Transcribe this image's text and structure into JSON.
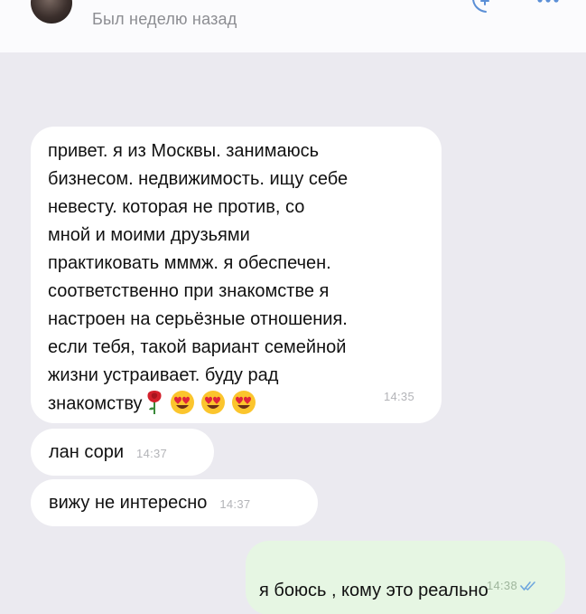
{
  "header": {
    "last_seen": "Был неделю назад",
    "avatar_icon": "avatar",
    "call_icon": "phone-plus-icon",
    "more_icon": "more-dots-icon"
  },
  "messages": [
    {
      "direction": "incoming",
      "text": "привет. я из Москвы. занимаюсь\nбизнесом. недвижимость. ищу себе\nневесту. которая не против, со\nмной и моими друзьями\nпрактиковать мммж. я обеспечен.\nсоответственно при знакомстве я\nнастроен на серьёзные отношения.\nесли тебя, такой вариант семейной\nжизни устраивает. буду рад\nзнакомству",
      "emojis": [
        "rose-emoji",
        "heart-eyes-emoji",
        "heart-eyes-emoji",
        "heart-eyes-emoji"
      ],
      "time": "14:35"
    },
    {
      "direction": "incoming",
      "text": "лан сори",
      "time": "14:37"
    },
    {
      "direction": "incoming",
      "text": "вижу не интересно",
      "time": "14:37"
    },
    {
      "direction": "outgoing",
      "text": "я боюсь , кому это реально\nинтересно",
      "time": "14:38",
      "status_icon": "double-check-icon"
    }
  ],
  "colors": {
    "background": "#ebeaf0",
    "incoming_bubble": "#ffffff",
    "outgoing_bubble": "#e6f6e3",
    "time_text": "#b3b4b8",
    "read_check": "#6fa7de"
  }
}
